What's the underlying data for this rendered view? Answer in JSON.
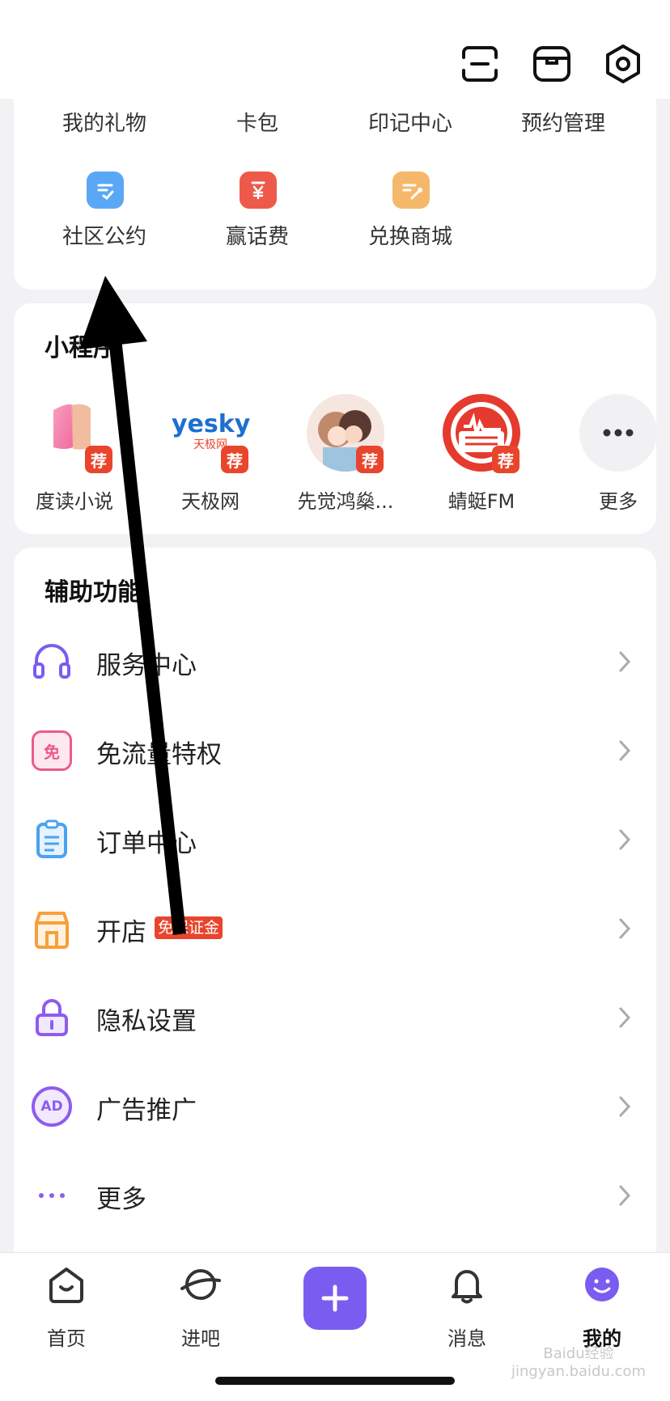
{
  "top_icons": [
    "scan-icon",
    "box-icon",
    "settings-icon"
  ],
  "tools_row1": [
    "我的礼物",
    "卡包",
    "印记中心",
    "预约管理"
  ],
  "tools_row2": [
    {
      "label": "社区公约",
      "icon": "community-rules-icon",
      "color": "#5aa8f5"
    },
    {
      "label": "赢话费",
      "icon": "phone-credit-icon",
      "color": "#ee5a4a"
    },
    {
      "label": "兑换商城",
      "icon": "exchange-mall-icon",
      "color": "#f5b86a"
    }
  ],
  "mini_programs": {
    "title": "小程序",
    "items": [
      {
        "label": "度读小说",
        "badge": "荐"
      },
      {
        "label": "天极网",
        "badge": "荐",
        "logo_main": "yesky",
        "logo_sub": "天极网"
      },
      {
        "label": "先觉鸿燊...",
        "badge": "荐"
      },
      {
        "label": "蜻蜓FM",
        "badge": "荐"
      },
      {
        "label": "更多"
      }
    ]
  },
  "assist": {
    "title": "辅助功能",
    "items": [
      {
        "label": "服务中心",
        "icon": "headset-icon"
      },
      {
        "label": "免流量特权",
        "icon": "free-data-icon",
        "icon_char": "免"
      },
      {
        "label": "订单中心",
        "icon": "order-icon"
      },
      {
        "label": "开店",
        "icon": "shop-icon",
        "badge": "免保证金"
      },
      {
        "label": "隐私设置",
        "icon": "lock-icon"
      },
      {
        "label": "广告推广",
        "icon": "ad-icon",
        "icon_char": "AD"
      },
      {
        "label": "更多",
        "icon": "more-dots-icon"
      }
    ]
  },
  "nav": {
    "items": [
      {
        "label": "首页",
        "icon": "home-icon"
      },
      {
        "label": "进吧",
        "icon": "planet-icon"
      },
      {
        "label": "",
        "icon": "plus-icon"
      },
      {
        "label": "消息",
        "icon": "bell-icon"
      },
      {
        "label": "我的",
        "icon": "profile-face-icon"
      }
    ]
  },
  "watermark": "Baidu经验 jingyan.baidu.com",
  "colors": {
    "accent": "#7b5cf0",
    "red": "#e8452c"
  }
}
